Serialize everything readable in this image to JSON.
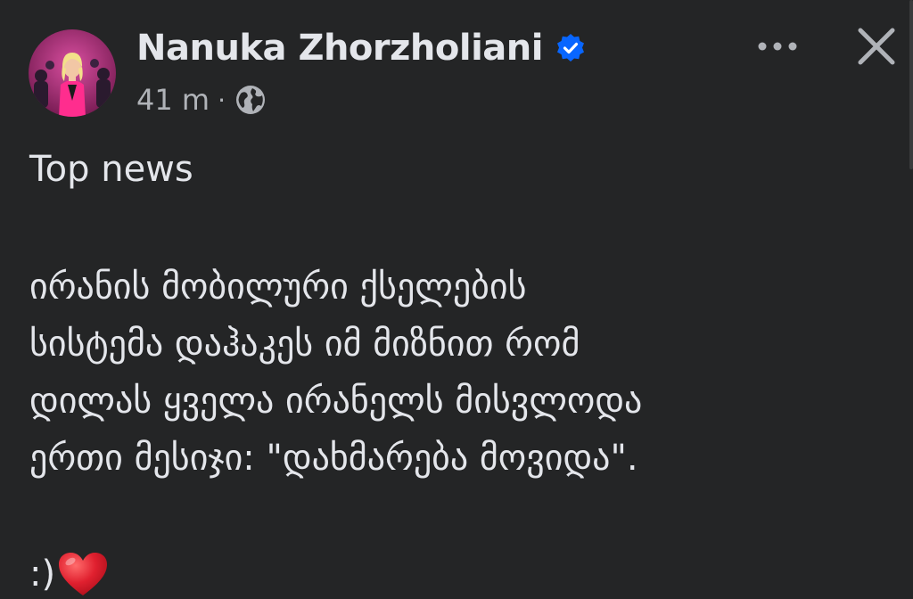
{
  "post": {
    "author": {
      "name": "Nanuka Zhorzholiani",
      "verified": true,
      "avatar_icon": "profile-photo"
    },
    "meta": {
      "time": "41 m",
      "separator": "·",
      "audience_icon": "globe-icon"
    },
    "actions": {
      "more_icon": "more-horizontal-icon",
      "close_icon": "close-icon"
    },
    "body": {
      "headline": "Top news",
      "lines": [
        "ირანის მობილური ქსელების",
        "სისტემა დაჰაკეს იმ მიზნით რომ",
        "დილას ყველა ირანელს მისვლოდა",
        "ერთი მესიჯი: \"დახმარება მოვიდა\"."
      ],
      "smiley": ":)",
      "emoji": "heart"
    }
  },
  "colors": {
    "background": "#242526",
    "primary_text": "#e4e6eb",
    "secondary_text": "#b0b3b8",
    "verified_blue": "#0866ff",
    "heart_red": "#e0202f"
  }
}
